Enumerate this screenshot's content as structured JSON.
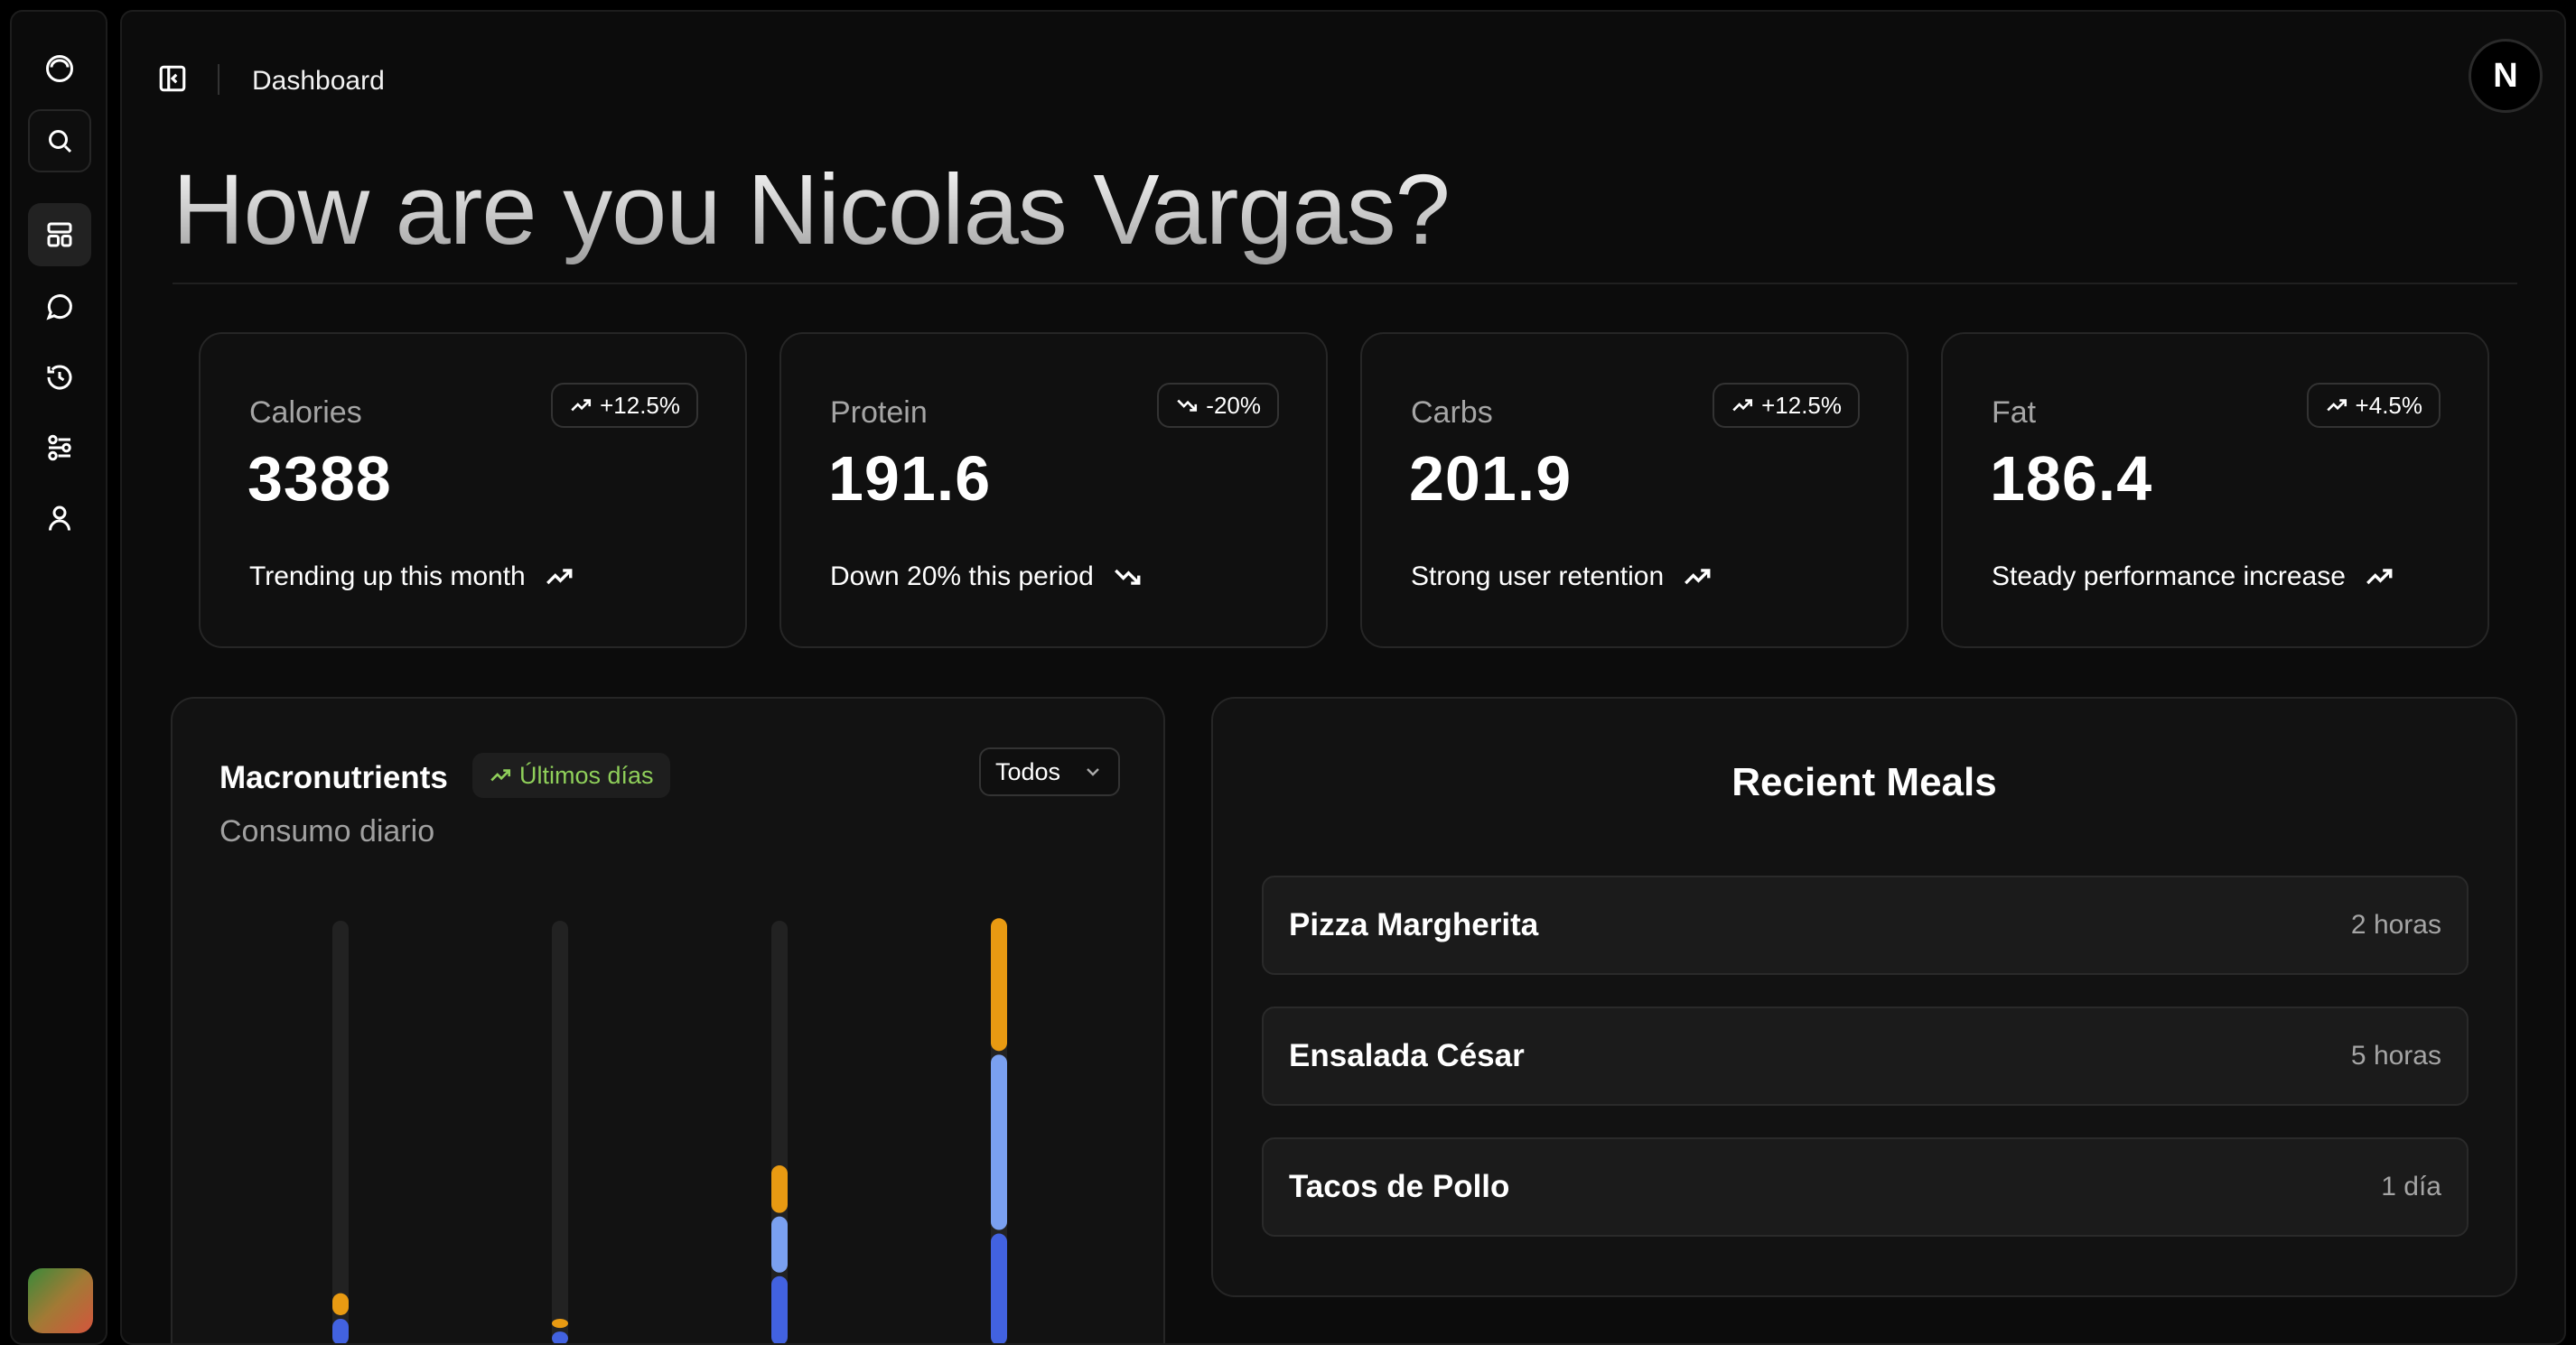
{
  "breadcrumb": "Dashboard",
  "user_initial": "N",
  "greeting": "How are you Nicolas Vargas?",
  "sidebar": {
    "items": [
      {
        "icon": "logo-circle-icon"
      },
      {
        "icon": "search-icon"
      },
      {
        "icon": "dashboard-icon"
      },
      {
        "icon": "chat-icon"
      },
      {
        "icon": "history-icon"
      },
      {
        "icon": "settings-icon"
      },
      {
        "icon": "user-icon"
      }
    ]
  },
  "stats": [
    {
      "label": "Calories",
      "badge": "+12.5%",
      "trend": "up",
      "value": "3388",
      "footer": "Trending up this month"
    },
    {
      "label": "Protein",
      "badge": "-20%",
      "trend": "down",
      "value": "191.6",
      "footer": "Down 20% this period"
    },
    {
      "label": "Carbs",
      "badge": "+12.5%",
      "trend": "up",
      "value": "201.9",
      "footer": "Strong user retention"
    },
    {
      "label": "Fat",
      "badge": "+4.5%",
      "trend": "up",
      "value": "186.4",
      "footer": "Steady performance increase"
    }
  ],
  "macro": {
    "title": "Macronutrients",
    "badge": "Últimos días",
    "subtitle": "Consumo diario",
    "select": "Todos"
  },
  "chart_data": {
    "type": "bar",
    "stacked": true,
    "categories": [
      "",
      "",
      "",
      ""
    ],
    "colors": {
      "dark_blue": "#4262e0",
      "light_blue": "#7aa0f0",
      "orange": "#e89a12",
      "track": "#222222"
    },
    "bars": [
      {
        "segments": [
          {
            "color": "dark_blue",
            "value": 0.07
          },
          {
            "color": "orange",
            "value": 0.06
          }
        ]
      },
      {
        "segments": [
          {
            "color": "dark_blue",
            "value": 0.04
          },
          {
            "color": "orange",
            "value": 0.03
          }
        ]
      },
      {
        "segments": [
          {
            "color": "dark_blue",
            "value": 0.17
          },
          {
            "color": "light_blue",
            "value": 0.14
          },
          {
            "color": "orange",
            "value": 0.12
          }
        ]
      },
      {
        "segments": [
          {
            "color": "dark_blue",
            "value": 0.27
          },
          {
            "color": "light_blue",
            "value": 0.42
          },
          {
            "color": "orange",
            "value": 0.32
          }
        ]
      }
    ]
  },
  "meals": {
    "title": "Recient Meals",
    "items": [
      {
        "name": "Pizza Margherita",
        "time": "2 horas"
      },
      {
        "name": "Ensalada César",
        "time": "5 horas"
      },
      {
        "name": "Tacos de Pollo",
        "time": "1 día"
      }
    ]
  }
}
